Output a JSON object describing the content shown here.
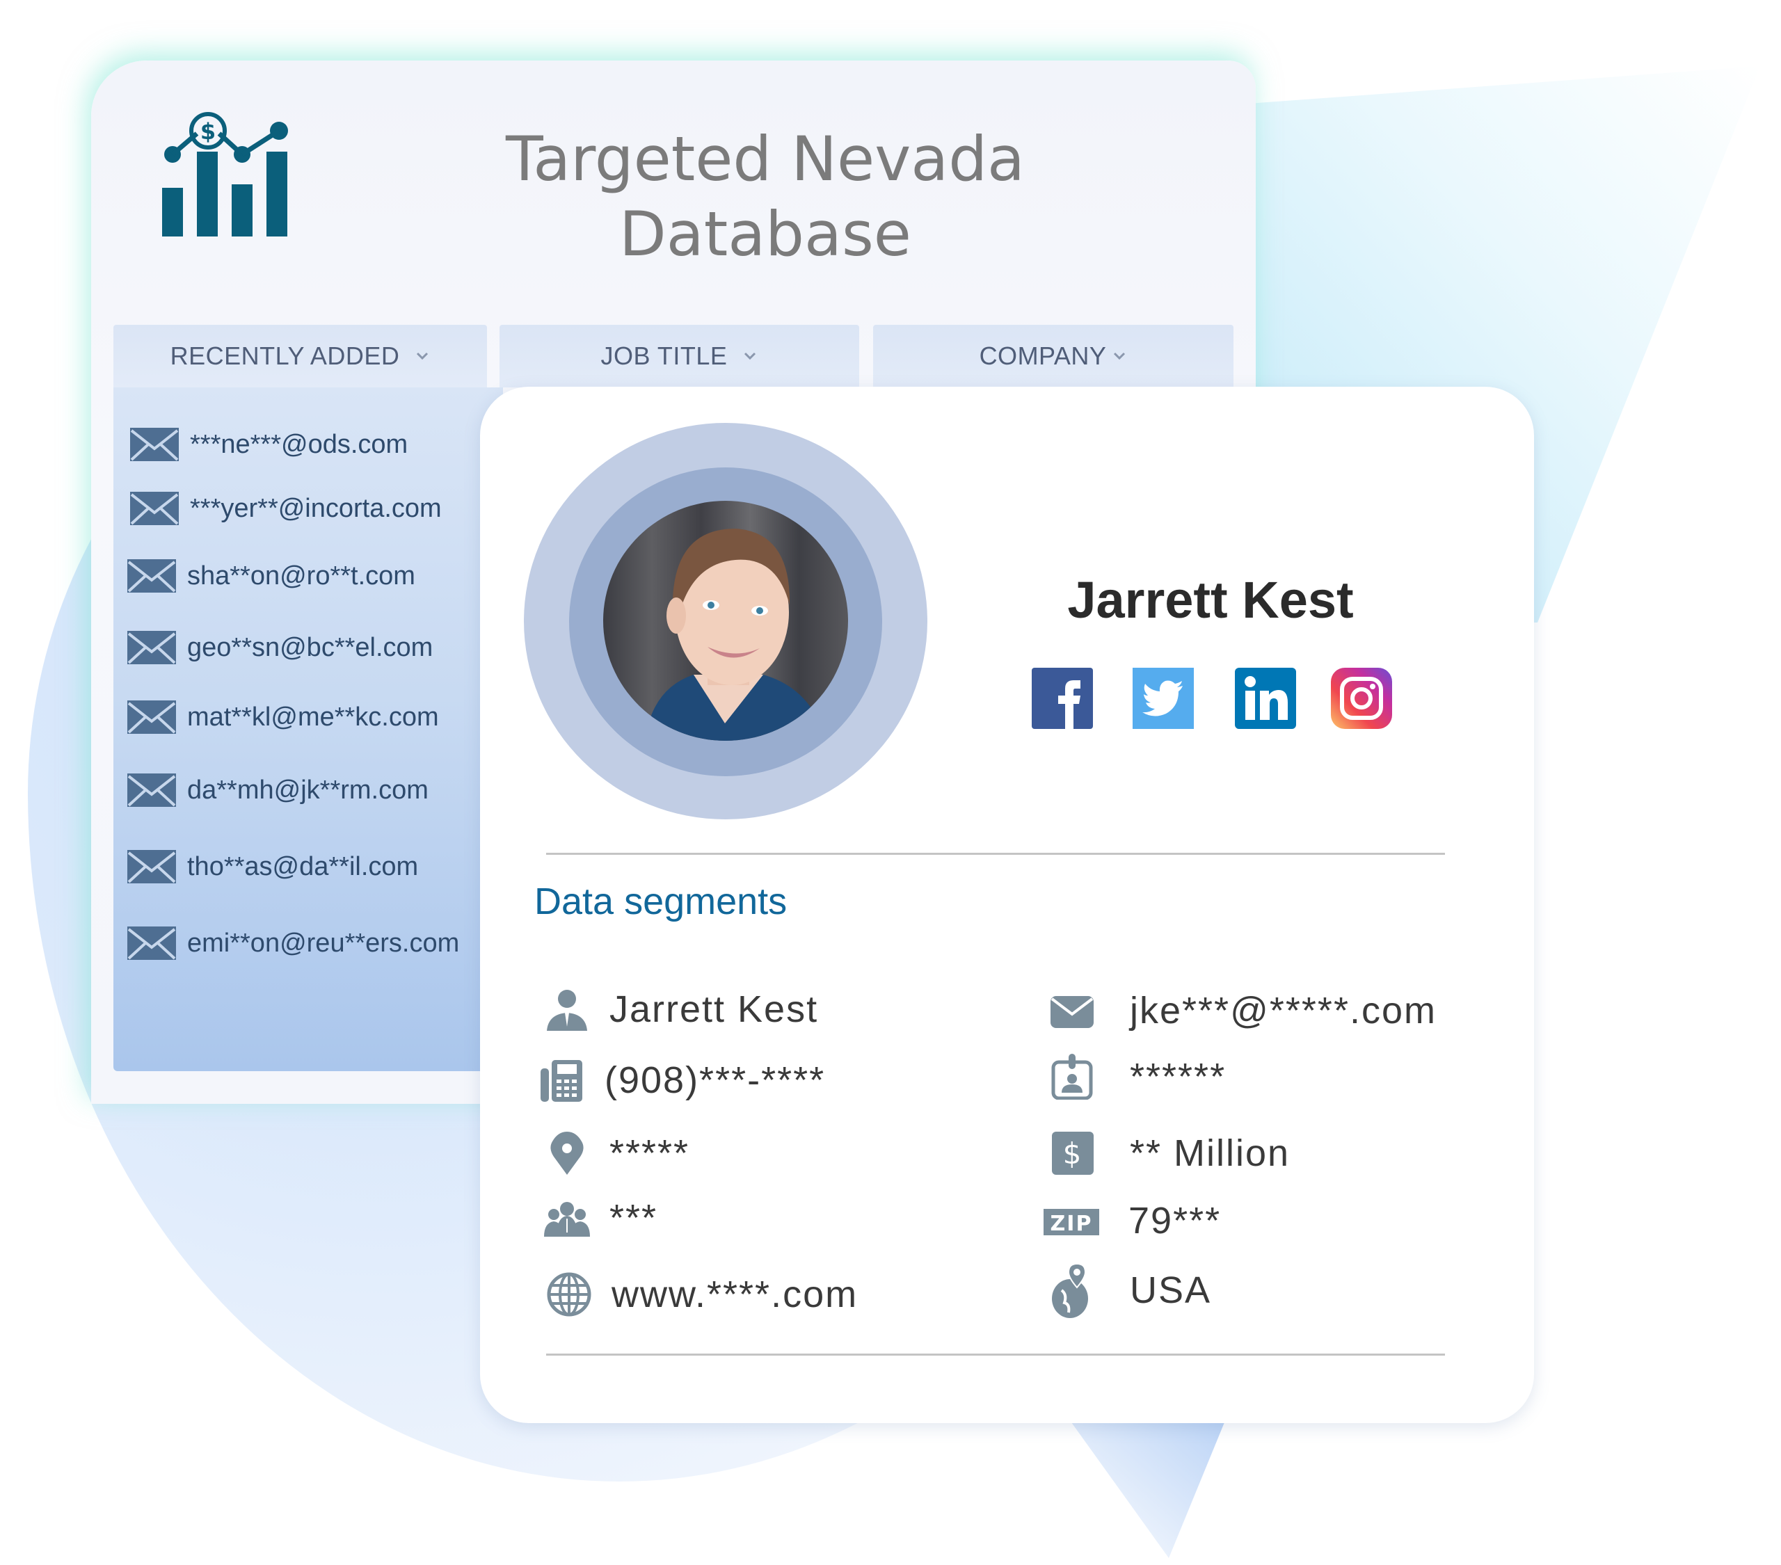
{
  "panel": {
    "title_line1": "Targeted Nevada",
    "title_line2": "Database",
    "logo_icon": "chart-dollar-icon"
  },
  "tabs": [
    {
      "label": "RECENTLY ADDED",
      "icon": "chevron-down-icon"
    },
    {
      "label": "JOB TITLE",
      "icon": "chevron-down-icon"
    },
    {
      "label": "COMPANY",
      "icon": "chevron-down-icon"
    }
  ],
  "emails": [
    "***ne***@ods.com",
    "***yer**@incorta.com",
    "sha**on@ro**t.com",
    "geo**sn@bc**el.com",
    "mat**kl@me**kc.com",
    "da**mh@jk**rm.com",
    "tho**as@da**il.com",
    "emi**on@reu**ers.com"
  ],
  "profile": {
    "name": "Jarrett Kest",
    "avatar": "profile-photo",
    "social": [
      {
        "name": "facebook",
        "color": "#3b5998"
      },
      {
        "name": "twitter",
        "color": "#55acee"
      },
      {
        "name": "linkedin",
        "color": "#0077b5"
      },
      {
        "name": "instagram",
        "color": "#c13584"
      }
    ]
  },
  "segments": {
    "title": "Data segments",
    "left": [
      {
        "icon": "person-icon",
        "value": "Jarrett Kest"
      },
      {
        "icon": "phone-icon",
        "value": "(908)***-****"
      },
      {
        "icon": "location-pin-icon",
        "value": "*****"
      },
      {
        "icon": "team-icon",
        "value": "***"
      },
      {
        "icon": "globe-icon",
        "value": "www.****.com"
      }
    ],
    "right": [
      {
        "icon": "envelope-icon",
        "value": "jke***@*****.com"
      },
      {
        "icon": "id-badge-icon",
        "value": "******"
      },
      {
        "icon": "dollar-icon",
        "value": "** Million"
      },
      {
        "icon": "zip-icon",
        "value": "79***"
      },
      {
        "icon": "globe-pin-icon",
        "value": "USA"
      }
    ]
  },
  "colors": {
    "accent": "#11679a",
    "logo": "#0b5f7b",
    "icon_gray": "#7a8d9a",
    "email_text": "#2e4a6c"
  }
}
